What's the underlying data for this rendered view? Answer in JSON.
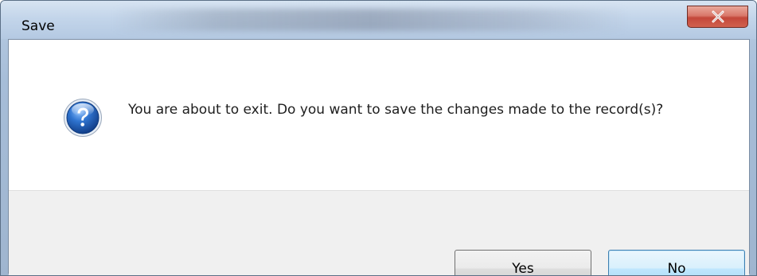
{
  "window": {
    "title": "Save",
    "close_icon": "close-icon"
  },
  "dialog": {
    "icon": "question-icon",
    "message": "You are about to exit. Do you want to save the changes made to the record(s)?"
  },
  "buttons": {
    "yes_label": "Yes",
    "no_label": "No"
  },
  "colors": {
    "titlebar": "#c3d5ea",
    "close_button": "#c4483a",
    "footer": "#f0f0f0",
    "default_button": "#bee6fd",
    "icon_blue": "#1f5fb3"
  }
}
